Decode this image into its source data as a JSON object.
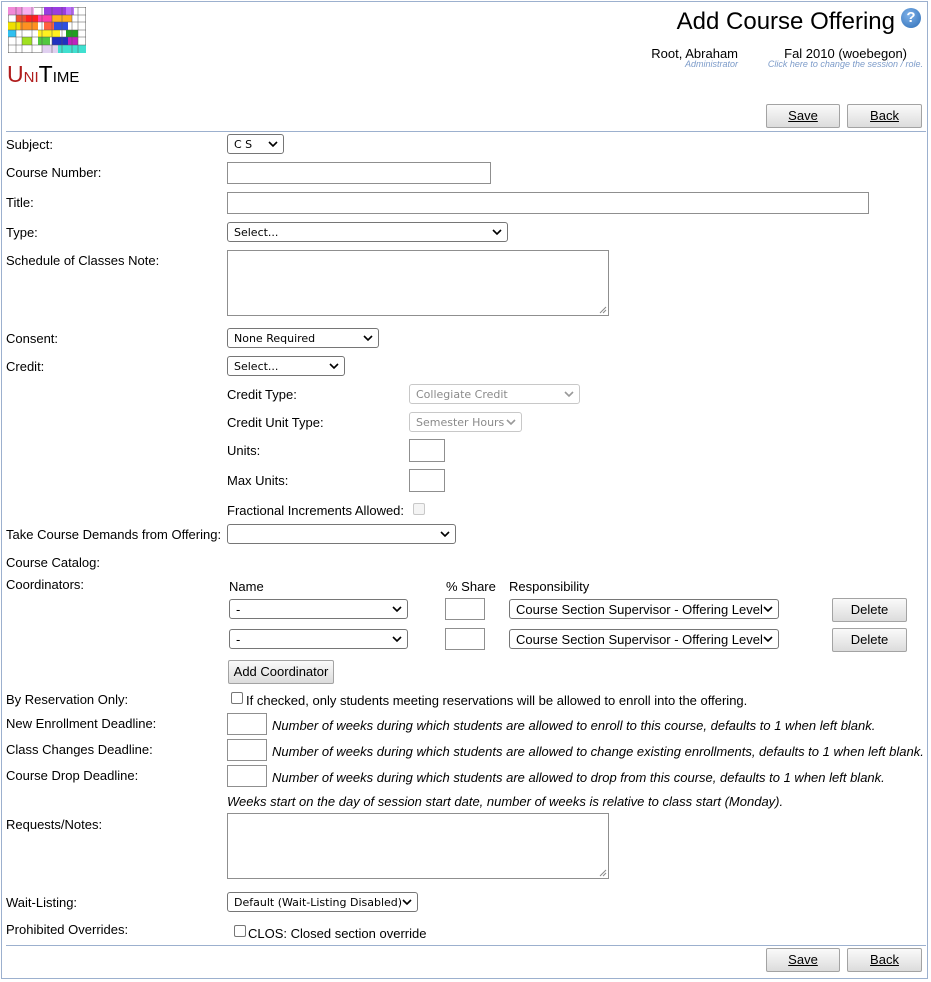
{
  "header": {
    "title": "Add Course Offering",
    "help_icon": "?",
    "logo": {
      "brand_u": "U",
      "brand_ni": "NI",
      "brand_t": "T",
      "brand_ime": "IME"
    },
    "user": {
      "name": "Root, Abraham",
      "role": "Administrator"
    },
    "session": {
      "name": "Fal 2010 (woebegon)",
      "hint": "Click here to change the session / role."
    }
  },
  "toolbar": {
    "save_label": "Save",
    "back_label": "Back"
  },
  "form": {
    "subject": {
      "label": "Subject:",
      "value": "C S"
    },
    "course_number": {
      "label": "Course Number:",
      "value": ""
    },
    "title": {
      "label": "Title:",
      "value": ""
    },
    "type": {
      "label": "Type:",
      "value": "Select..."
    },
    "schedule_note": {
      "label": "Schedule of Classes Note:",
      "value": ""
    },
    "consent": {
      "label": "Consent:",
      "value": "None Required"
    },
    "credit": {
      "label": "Credit:",
      "value": "Select...",
      "credit_type": {
        "label": "Credit Type:",
        "value": "Collegiate Credit"
      },
      "credit_unit_type": {
        "label": "Credit Unit Type:",
        "value": "Semester Hours"
      },
      "units": {
        "label": "Units:",
        "value": ""
      },
      "max_units": {
        "label": "Max Units:",
        "value": ""
      },
      "fractional": {
        "label": "Fractional Increments Allowed:",
        "checked": false
      }
    },
    "take_demands": {
      "label": "Take Course Demands from Offering:",
      "value": ""
    },
    "course_catalog": {
      "label": "Course Catalog:"
    },
    "coordinators": {
      "label": "Coordinators:",
      "headers": {
        "name": "Name",
        "share": "% Share",
        "responsibility": "Responsibility"
      },
      "rows": [
        {
          "name": "-",
          "share": "",
          "responsibility": "Course Section Supervisor - Offering Level",
          "delete_label": "Delete"
        },
        {
          "name": "-",
          "share": "",
          "responsibility": "Course Section Supervisor - Offering Level",
          "delete_label": "Delete"
        }
      ],
      "add_label": "Add Coordinator"
    },
    "by_reservation": {
      "label": "By Reservation Only:",
      "text": "If checked, only students meeting reservations will be allowed to enroll into the offering.",
      "checked": false
    },
    "new_enrollment": {
      "label": "New Enrollment Deadline:",
      "value": "",
      "note": "Number of weeks during which students are allowed to enroll to this course, defaults to 1 when left blank."
    },
    "class_changes": {
      "label": "Class Changes Deadline:",
      "value": "",
      "note": "Number of weeks during which students are allowed to change existing enrollments, defaults to 1 when left blank."
    },
    "course_drop": {
      "label": "Course Drop Deadline:",
      "value": "",
      "note": "Number of weeks during which students are allowed to drop from this course, defaults to 1 when left blank."
    },
    "weeks_note": "Weeks start on the day of session start date, number of weeks is relative to class start (Monday).",
    "requests_notes": {
      "label": "Requests/Notes:",
      "value": ""
    },
    "wait_listing": {
      "label": "Wait-Listing:",
      "value": "Default (Wait-Listing Disabled)"
    },
    "prohibited_overrides": {
      "label": "Prohibited Overrides:",
      "option": "CLOS: Closed section override",
      "checked": false
    }
  },
  "colors": {
    "border": "#9cb0ce",
    "brand_red": "#b01c1c",
    "help_blue": "#3e7ec4",
    "hint_blue": "#7c9bc9"
  }
}
